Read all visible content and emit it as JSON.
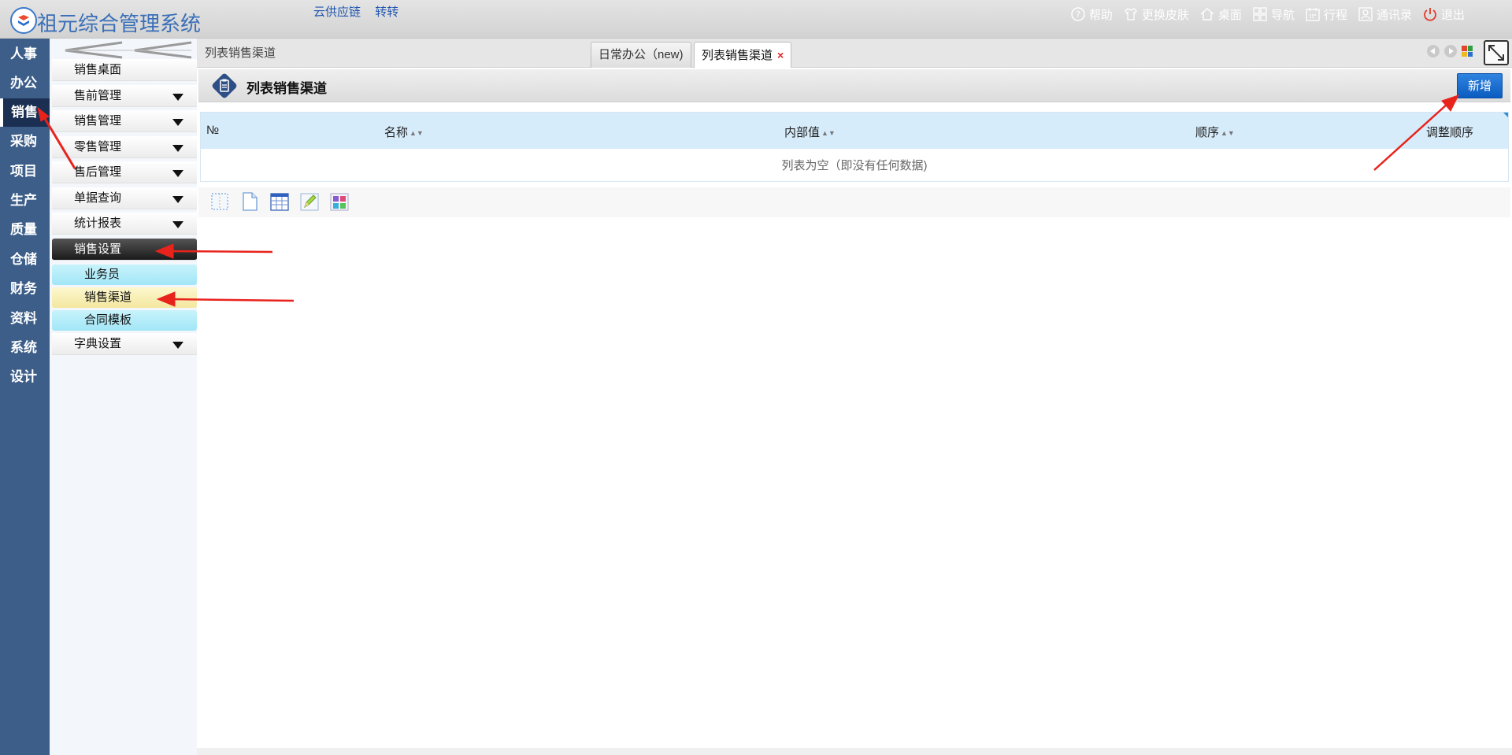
{
  "header": {
    "app_title": "祖元综合管理系统",
    "links": [
      "云供应链",
      "转转"
    ],
    "actions": [
      {
        "label": "帮助",
        "icon": "help-icon"
      },
      {
        "label": "更换皮肤",
        "icon": "shirt-icon"
      },
      {
        "label": "桌面",
        "icon": "home-icon"
      },
      {
        "label": "导航",
        "icon": "grid-icon"
      },
      {
        "label": "行程",
        "icon": "calendar-icon"
      },
      {
        "label": "通讯录",
        "icon": "contacts-icon"
      },
      {
        "label": "退出",
        "icon": "power-icon"
      }
    ]
  },
  "modules": [
    "人事",
    "办公",
    "销售",
    "采购",
    "项目",
    "生产",
    "质量",
    "仓储",
    "财务",
    "资料",
    "系统",
    "设计"
  ],
  "active_module": "销售",
  "menu": {
    "items": [
      {
        "label": "销售桌面",
        "expandable": false
      },
      {
        "label": "售前管理",
        "expandable": true
      },
      {
        "label": "销售管理",
        "expandable": true
      },
      {
        "label": "零售管理",
        "expandable": true
      },
      {
        "label": "售后管理",
        "expandable": true
      },
      {
        "label": "单据查询",
        "expandable": true
      },
      {
        "label": "统计报表",
        "expandable": true
      },
      {
        "label": "销售设置",
        "expandable": false,
        "open": true
      },
      {
        "label": "字典设置",
        "expandable": true
      }
    ],
    "sub_items": [
      "业务员",
      "销售渠道",
      "合同模板"
    ],
    "selected_sub": "销售渠道"
  },
  "breadcrumb": "列表销售渠道",
  "tabs": [
    {
      "label": "日常办公（new)",
      "closable": false
    },
    {
      "label": "列表销售渠道",
      "closable": true,
      "close_glyph": "×"
    }
  ],
  "page": {
    "title": "列表销售渠道",
    "add_button": "新增"
  },
  "table": {
    "columns": [
      "№",
      "名称",
      "内部值",
      "顺序",
      "调整顺序"
    ],
    "sortable": [
      false,
      true,
      true,
      true,
      false
    ],
    "empty_text": "列表为空（即没有任何数据)"
  },
  "toolbar_icons": [
    "select-all-icon",
    "export-icon",
    "table-icon",
    "edit-icon",
    "puzzle-icon"
  ],
  "colors": {
    "module_bar": "#3c5e89",
    "primary_button": "#0b5cc0",
    "table_header": "#d7ecfb",
    "annotation_arrow": "#e8231c"
  }
}
